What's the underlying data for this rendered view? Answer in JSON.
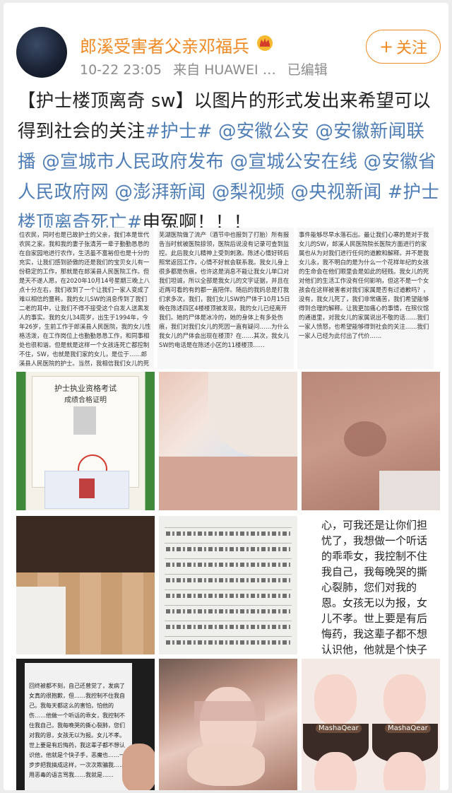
{
  "post": {
    "username": "郎溪受害者父亲邓福兵",
    "timestamp": "10-22 23:05",
    "source": "来自 HUAWEI …",
    "edited": "已编辑",
    "follow_label": "关注",
    "text_segments": [
      {
        "type": "text",
        "value": "【护士楼顶离奇 sw】以图片的形式发出来希望可以得到社会的关注"
      },
      {
        "type": "tag",
        "value": "#护士#"
      },
      {
        "type": "text",
        "value": " "
      },
      {
        "type": "at",
        "value": "@安徽公安"
      },
      {
        "type": "text",
        "value": " "
      },
      {
        "type": "at",
        "value": "@安徽新闻联播"
      },
      {
        "type": "text",
        "value": " "
      },
      {
        "type": "at",
        "value": "@宣城市人民政府发布"
      },
      {
        "type": "text",
        "value": " "
      },
      {
        "type": "at",
        "value": "@宣城公安在线"
      },
      {
        "type": "text",
        "value": " "
      },
      {
        "type": "at",
        "value": "@安徽省人民政府网"
      },
      {
        "type": "text",
        "value": " "
      },
      {
        "type": "at",
        "value": "@澎湃新闻"
      },
      {
        "type": "text",
        "value": " "
      },
      {
        "type": "at",
        "value": "@梨视频"
      },
      {
        "type": "text",
        "value": " "
      },
      {
        "type": "at",
        "value": "@央视新闻"
      },
      {
        "type": "text",
        "value": " "
      },
      {
        "type": "tag",
        "value": "#护士楼顶离奇死亡#"
      },
      {
        "type": "text",
        "value": "申冤啊！！！"
      }
    ]
  },
  "images": {
    "letter_1": "位农民，同时也是已故护士的父亲，我们本是世代农民之家。我和我的妻子张清芳一辈子勤勤恳恳的在自家园地进行农作，生活虽不富裕但也是十分的充实，让我们感到骄傲的还是我们的宝贝女儿有一份稳定的工作，那就是在郎溪县人民医院工作。但是天不遂人愿，在2020年10月14号星期三晚上八点十分左右，我们收到了一个让我们一家人变成了难以相信的噩耗，我的女儿SW的消息传到了我们二老的耳中，让我们不得不接受这个白发人送黑发人的事实。我的女儿34周岁，出生于1994年，今年26岁，生前工作于郎溪县人民医院，我的女儿性格活泼，在工作岗位上也勤勤恳恳工作，和同事相处也很和谐。但是就是这样一个女孩连死亡都控制不住，SW，也就是我们家的女儿，是位于……郎溪县人民医院的护士。当然，我相信我们女儿的死因……",
    "letter_2": "芜湖医院做了流产（酒节中也报到了打胎）所有报告当时就被医院掠领，医院后说没有记录可查到监控。此后我女儿精神上受到刺激。陈述心情好转后照常返回工作，心情不好就会联系我。我女儿身上很多都是伤痕，也许这是消息不能让我女儿单口对我们坦诚，所以全部是我女儿的文字证据，并且在近两可看的有的都一直陪伴。随后的我妈总是打我们求多次，我们，我们女儿SW的尸体于10月15日晚在陈述四区4楼楼顶被发现，我的女儿已经离开我们。她的尸体是冰冷的，她的身体上有多处伤痕，我们对我们女儿的死因一直有疑问……为什么我女儿的尸体会出现在楼顶？在……其次，我女儿SW的电话是在陈述小区的11楼楼顶……",
    "letter_3": "事件能够尽早水落石出。最让我们心寒的是对于我女儿的SW，郎溪人民医院院长医院方面进行的家属也从为对我们进行任何的道歉和解释。并不是我女儿永，我不明白的是为什么一个花样年纪的女孩的生命会在他们眼里会是如此的轻贱。我女儿的死对他们的生活工作没有任何影响，但这不是一个女孩会在这样被害者对我们家属是否有过道歉吗？，没有，我女儿死了，我们非常痛苦，我们希望能够得到合理的解释。让我更加痛心的事情，在殡仪馆的通道里，对我女儿的家属说出不敬的话……我们一家人愤怒，也希望能够得到社会的关注……我们一家人已经为此付出了代价……",
    "cert": {
      "title": "护士执业资格考试",
      "subtitle": "成绩合格证明"
    },
    "note_text": "心，可我还是让你们担忧了，我想做一个听话的乖乖女，我控制不住我自己，我每晚哭的撕心裂肺，您们对我的恩。女孩无以为报，女儿不孝。世上要是有后悔药，我这辈子都不想认识他，他就是个快子手，恶魔也……一步步把我搞成这样，一次次欺骗我，哄吧，还用恶毒的语言骂我……我要不……",
    "phone_text": "回终被都不刻，自己还曾觉了，发病了女真的很抱歉，但……我控制不住我自己。我每天都这么的害怕，怕他的伤……他做一个听话的乖女，我控制不住我自己，我每晚哭的撕心裂肺，您们对我的恩，女孩无以为报。女儿不孝。世上要是有后悔药，我这辈子都不想认识他，他就是个快子手，恶魔也……一步步把我搞成这样，一次次欺骗我……用恶毒的语言骂我……我就是……",
    "collage_brand": "MashaQear"
  },
  "colors": {
    "username": "#f08a24",
    "link": "#4f7db5",
    "meta": "#8c8c8c",
    "text": "#222222"
  }
}
